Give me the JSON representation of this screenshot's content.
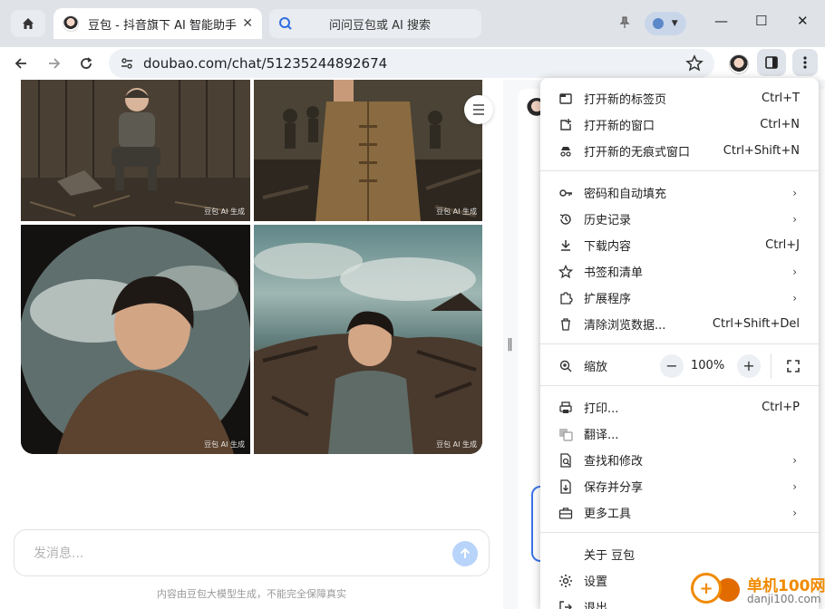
{
  "tab": {
    "title": "豆包 - 抖音旗下 AI 智能助手",
    "close": "✕"
  },
  "search_tab": {
    "label": "问问豆包或 AI 搜索"
  },
  "window": {
    "minimize": "—",
    "maximize": "☐",
    "close": "✕"
  },
  "omnibox": {
    "url": "doubao.com/chat/51235244892674"
  },
  "images": [
    {
      "watermark": "豆包 AI 生成"
    },
    {
      "watermark": "豆包 AI 生成"
    },
    {
      "watermark": "豆包 AI 生成"
    },
    {
      "watermark": "豆包 AI 生成"
    }
  ],
  "chat": {
    "placeholder": "发消息...",
    "disclaimer": "内容由豆包大模型生成，不能完全保障真实"
  },
  "menu": {
    "new_tab": {
      "label": "打开新的标签页",
      "shortcut": "Ctrl+T"
    },
    "new_window": {
      "label": "打开新的窗口",
      "shortcut": "Ctrl+N"
    },
    "incognito": {
      "label": "打开新的无痕式窗口",
      "shortcut": "Ctrl+Shift+N"
    },
    "passwords": {
      "label": "密码和自动填充"
    },
    "history": {
      "label": "历史记录"
    },
    "downloads": {
      "label": "下载内容",
      "shortcut": "Ctrl+J"
    },
    "bookmarks": {
      "label": "书签和清单"
    },
    "extensions": {
      "label": "扩展程序"
    },
    "clear_data": {
      "label": "清除浏览数据...",
      "shortcut": "Ctrl+Shift+Del"
    },
    "zoom": {
      "label": "缩放",
      "minus": "−",
      "value": "100%",
      "plus": "+"
    },
    "print": {
      "label": "打印...",
      "shortcut": "Ctrl+P"
    },
    "translate": {
      "label": "翻译..."
    },
    "find_edit": {
      "label": "查找和修改"
    },
    "save_share": {
      "label": "保存并分享"
    },
    "more_tools": {
      "label": "更多工具"
    },
    "about": {
      "label": "关于 豆包"
    },
    "settings": {
      "label": "设置"
    },
    "exit": {
      "label": "退出"
    }
  },
  "watermark_logo": {
    "name": "单机100网",
    "url": "danji100.com"
  }
}
